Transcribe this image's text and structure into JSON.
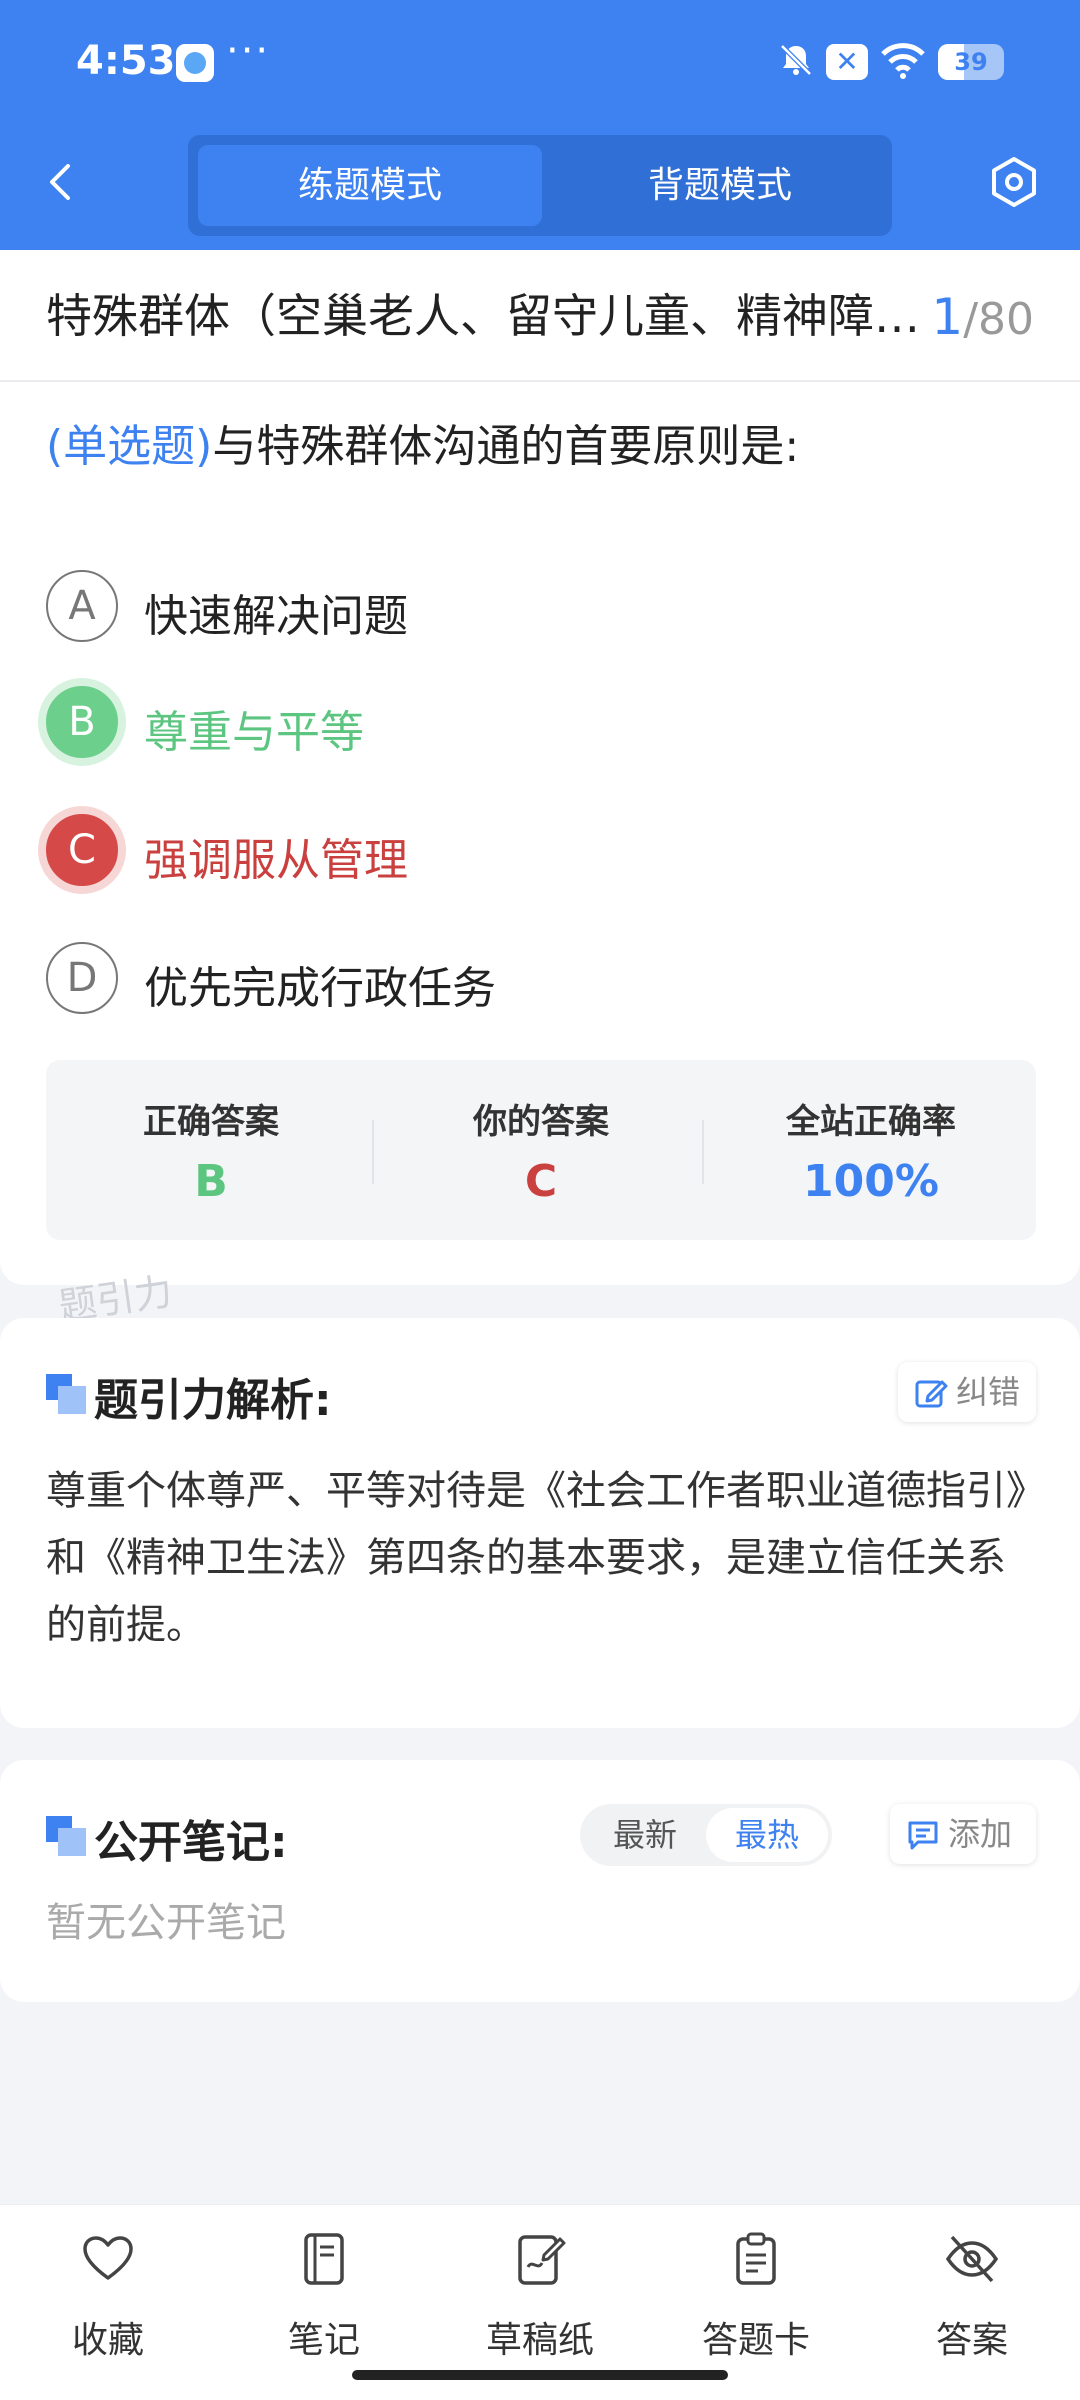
{
  "status_bar": {
    "time": "4:53",
    "dots": "···",
    "battery": "39",
    "battery_level": 0.39
  },
  "header": {
    "tabs": [
      {
        "label": "练题模式",
        "active": true
      },
      {
        "label": "背题模式",
        "active": false
      }
    ]
  },
  "question": {
    "title": "特殊群体（空巢老人、留守儿童、精神障碍患者）沟通",
    "current": "1",
    "total": "/80",
    "type": "(单选题)",
    "text": "与特殊群体沟通的首要原则是:",
    "options": [
      {
        "letter": "A",
        "text": "快速解决问题",
        "state": "normal"
      },
      {
        "letter": "B",
        "text": "尊重与平等",
        "state": "correct"
      },
      {
        "letter": "C",
        "text": "强调服从管理",
        "state": "wrong"
      },
      {
        "letter": "D",
        "text": "优先完成行政任务",
        "state": "normal"
      }
    ]
  },
  "result": {
    "correct_label": "正确答案",
    "correct_value": "B",
    "yours_label": "你的答案",
    "yours_value": "C",
    "rate_label": "全站正确率",
    "rate_value": "100%"
  },
  "watermark": "题引力",
  "analysis": {
    "title": "题引力解析:",
    "report_label": "纠错",
    "text": "尊重个体尊严、平等对待是《社会工作者职业道德指引》和《精神卫生法》第四条的基本要求，是建立信任关系的前提。"
  },
  "notes": {
    "title": "公开笔记:",
    "sort_new": "最新",
    "sort_hot": "最热",
    "add_label": "添加",
    "empty": "暂无公开笔记"
  },
  "bottom_nav": [
    {
      "label": "收藏",
      "icon": "heart-icon"
    },
    {
      "label": "笔记",
      "icon": "notebook-icon"
    },
    {
      "label": "草稿纸",
      "icon": "draft-icon"
    },
    {
      "label": "答题卡",
      "icon": "answer-sheet-icon"
    },
    {
      "label": "答案",
      "icon": "eye-off-icon"
    }
  ],
  "colors": {
    "brand": "#3d82f0",
    "correct": "#5cc681",
    "wrong": "#c9403f"
  }
}
